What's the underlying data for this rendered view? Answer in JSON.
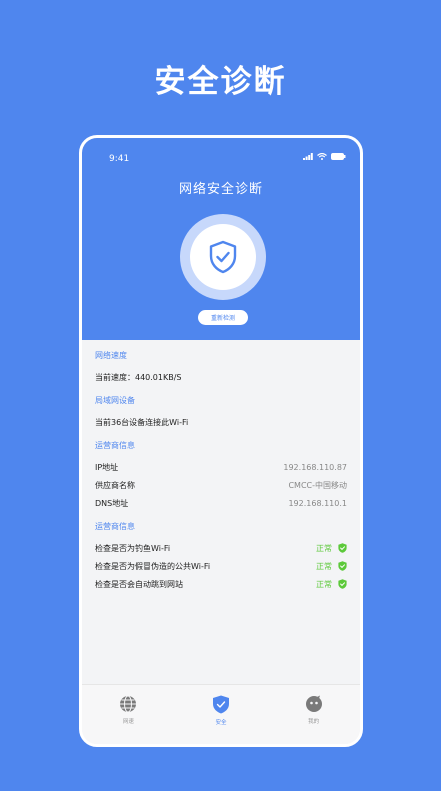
{
  "promo": {
    "title": "安全诊断"
  },
  "status": {
    "time": "9:41"
  },
  "header": {
    "title": "网络安全诊断",
    "recheck_label": "重新检测"
  },
  "sections": {
    "speed": {
      "title": "网络速度",
      "label": "当前速度：440.01KB/S"
    },
    "lan": {
      "title": "局域网设备",
      "label": "当前36台设备连接此Wi-Fi"
    },
    "isp": {
      "title": "运营商信息",
      "rows": [
        {
          "label": "IP地址",
          "value": "192.168.110.87"
        },
        {
          "label": "供应商名称",
          "value": "CMCC-中国移动"
        },
        {
          "label": "DNS地址",
          "value": "192.168.110.1"
        }
      ]
    },
    "checks": {
      "title": "运营商信息",
      "rows": [
        {
          "label": "检查是否为钓鱼Wi-Fi",
          "status": "正常"
        },
        {
          "label": "检查是否为假冒伪造的公共Wi-Fi",
          "status": "正常"
        },
        {
          "label": "检查是否会自动跳到网站",
          "status": "正常"
        }
      ]
    }
  },
  "tabs": [
    {
      "label": "网速",
      "icon": "globe-icon"
    },
    {
      "label": "安全",
      "icon": "shield-icon"
    },
    {
      "label": "我的",
      "icon": "profile-icon"
    }
  ],
  "colors": {
    "accent": "#4f86ee",
    "ok": "#5cc93a"
  }
}
